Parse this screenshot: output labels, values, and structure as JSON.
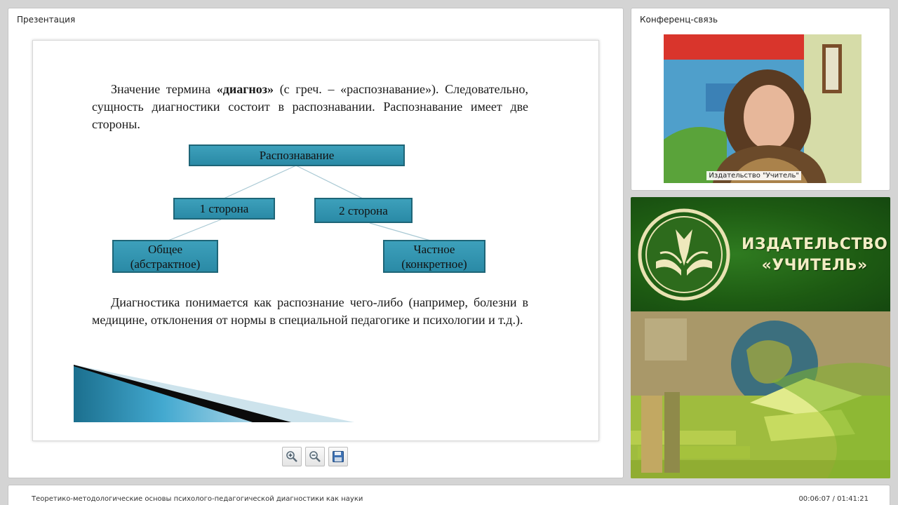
{
  "presentation": {
    "title": "Презентация",
    "slide": {
      "para1_before": "Значение термина ",
      "para1_term": "«диагноз»",
      "para1_after": " (с греч. – «распознавание»). Следовательно, сущность диагностики состоит в распознавании. Распознавание имеет две стороны.",
      "diagram": {
        "root": "Распознавание",
        "side1": "1 сторона",
        "side2": "2 сторона",
        "leaf1_line1": "Общее",
        "leaf1_line2": "(абстрактное)",
        "leaf2_line1": "Частное",
        "leaf2_line2": "(конкретное)"
      },
      "para2": "Диагностика понимается как распознание чего-либо (например, болезни в медицине, отклонения от нормы в специальной педагогике и психологии и т.д.)."
    },
    "toolbar": {
      "zoom_in_icon": "zoom-in-icon",
      "zoom_out_icon": "zoom-out-icon",
      "save_icon": "save-icon"
    }
  },
  "conference": {
    "title": "Конференц-связь",
    "caption": "Издательство \"Учитель\""
  },
  "publisher": {
    "name_line1": "ИЗДАТЕЛЬСТВО",
    "name_line2": "«УЧИТЕЛЬ»"
  },
  "footer": {
    "lecture_title": "Теоретико-методологические основы психолого-педагогической диагностики как науки",
    "time": "00:06:07 / 01:41:21"
  },
  "colors": {
    "diagram_box": "#31849b",
    "banner_green": "#1d5a12",
    "banner_text": "#f2edc4"
  }
}
